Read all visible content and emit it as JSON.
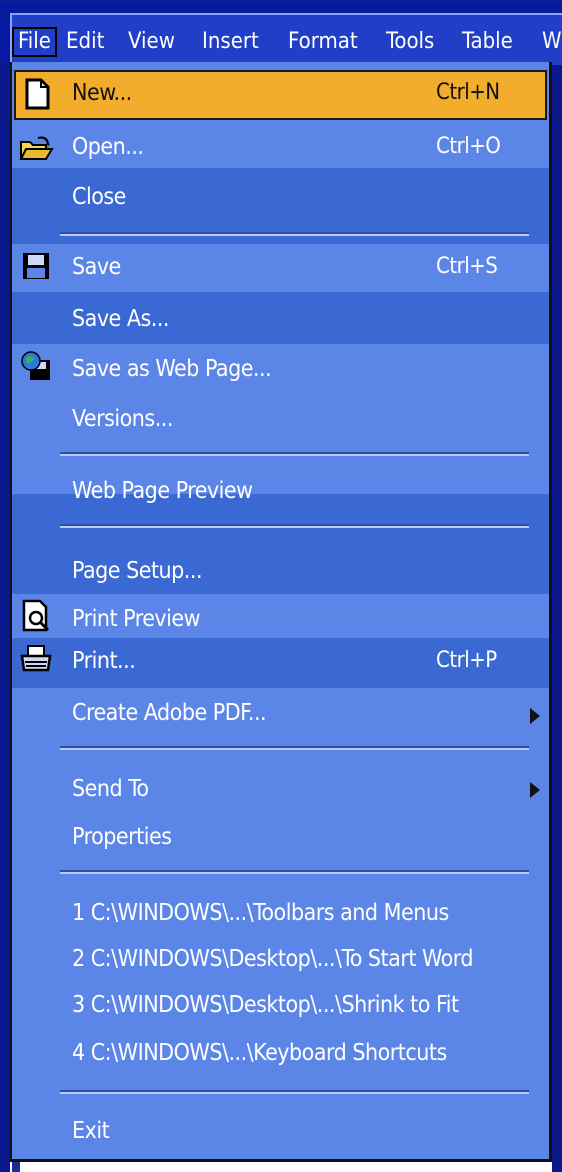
{
  "menubar": {
    "items": [
      "File",
      "Edit",
      "View",
      "Insert",
      "Format",
      "Tools",
      "Table",
      "W"
    ]
  },
  "menu": {
    "items": [
      {
        "label": "New...",
        "shortcut": "Ctrl+N",
        "icon": "new-document-icon"
      },
      {
        "label": "Open...",
        "shortcut": "Ctrl+O",
        "icon": "open-folder-icon"
      },
      {
        "label": "Close"
      },
      {
        "label": "Save",
        "shortcut": "Ctrl+S",
        "icon": "floppy-disk-icon"
      },
      {
        "label": "Save As..."
      },
      {
        "label": "Save as Web Page...",
        "icon": "web-page-save-icon"
      },
      {
        "label": "Versions..."
      },
      {
        "label": "Web Page Preview"
      },
      {
        "label": "Page Setup..."
      },
      {
        "label": "Print Preview",
        "icon": "print-preview-icon"
      },
      {
        "label": "Print...",
        "shortcut": "Ctrl+P",
        "icon": "printer-icon"
      },
      {
        "label": "Create Adobe PDF..."
      },
      {
        "label": "Send To"
      },
      {
        "label": "Properties"
      },
      {
        "label": "1 C:\\WINDOWS\\...\\Toolbars and Menus"
      },
      {
        "label": "2 C:\\WINDOWS\\Desktop\\...\\To Start Word"
      },
      {
        "label": "3 C:\\WINDOWS\\Desktop\\...\\Shrink to Fit"
      },
      {
        "label": "4 C:\\WINDOWS\\...\\Keyboard Shortcuts"
      },
      {
        "label": "Exit"
      }
    ]
  },
  "colors": {
    "menu_bg": "#5b86e8",
    "menu_band_dark": "#3a69d3",
    "highlight": "#f3ad2c",
    "menubar_bg": "#203ec6"
  }
}
